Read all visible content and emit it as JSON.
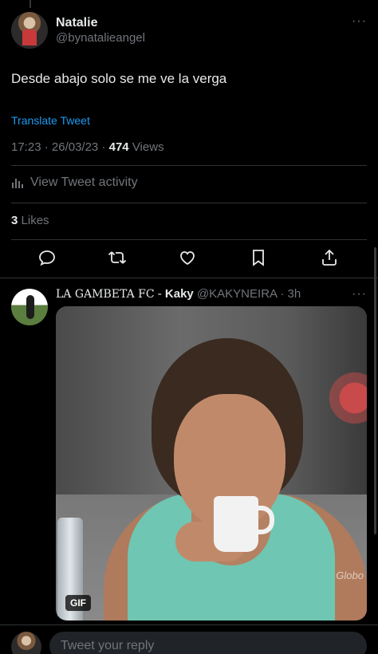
{
  "tweet": {
    "display_name": "Natalie",
    "handle": "@bynatalieangel",
    "text": "Desde abajo solo se me ve la verga",
    "translate_label": "Translate Tweet",
    "time": "17:23",
    "date": "26/03/23",
    "views_count": "474",
    "views_label": "Views",
    "activity_label": "View Tweet activity",
    "likes_count": "3",
    "likes_label": "Likes",
    "more": "···"
  },
  "actions": [
    {
      "icon": "reply-icon"
    },
    {
      "icon": "retweet-icon"
    },
    {
      "icon": "like-icon"
    },
    {
      "icon": "bookmark-icon"
    },
    {
      "icon": "share-icon"
    }
  ],
  "reply": {
    "club": "LA GAMBETA FC",
    "dash": "-",
    "display_name": "Kaky",
    "handle": "@KAKYNEIRA",
    "age": "· 3h",
    "more": "···",
    "media": {
      "badge": "GIF",
      "watermark": "Globo"
    }
  },
  "composer": {
    "placeholder": "Tweet your reply"
  },
  "colors": {
    "background": "#000000",
    "text": "#e7e9ea",
    "muted": "#71767b",
    "link": "#1d9bf0",
    "divider": "#2f3336"
  }
}
